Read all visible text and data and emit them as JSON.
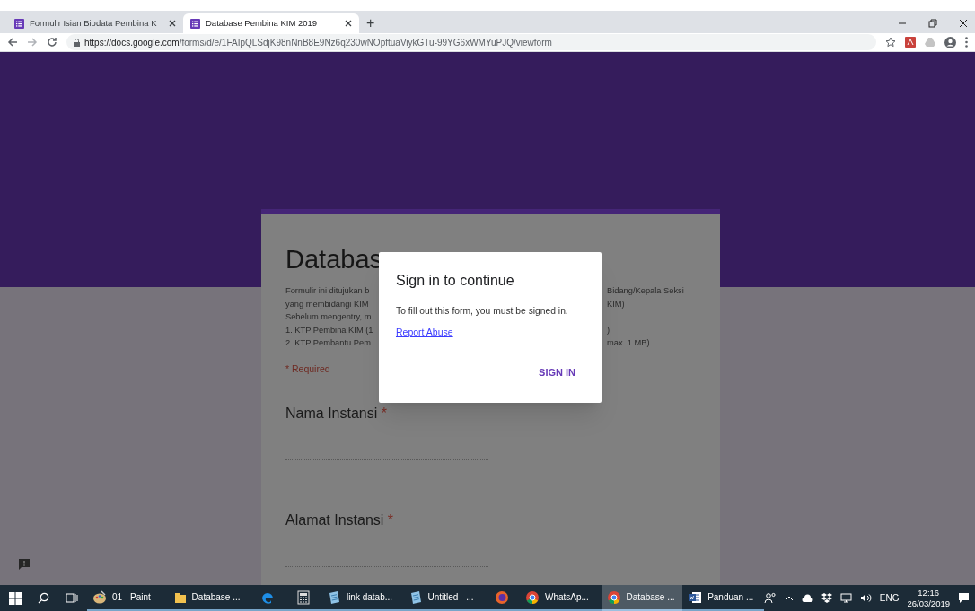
{
  "browser": {
    "tabs": [
      {
        "title": "Formulir Isian Biodata Pembina K",
        "selected": false
      },
      {
        "title": "Database Pembina KIM 2019",
        "selected": true
      }
    ],
    "new_tab": "+",
    "url_host": "https://docs.google.com",
    "url_path": "/forms/d/e/1FAIpQLSdjK98nNnB8E9Nz6q230wNOpftuaViykGTu-99YG6xWMYuPJQ/viewform"
  },
  "form": {
    "title": "Databas",
    "description_lines": [
      {
        "left": "Formulir ini ditujukan b",
        "right": "Bidang/Kepala Seksi"
      },
      {
        "left": "yang membidangi KIM",
        "right": "KIM)"
      },
      {
        "left": "Sebelum mengentry, m"
      },
      {
        "left": "1. KTP Pembina KIM (1",
        "right": ")"
      },
      {
        "left": "2. KTP Pembantu Pem",
        "right": "max. 1 MB)"
      }
    ],
    "required_note": "* Required",
    "questions": [
      {
        "label": "Nama Instansi",
        "mark": "*"
      },
      {
        "label": "Alamat Instansi",
        "mark": "*"
      }
    ]
  },
  "dialog": {
    "title": "Sign in to continue",
    "message": "To fill out this form, you must be signed in.",
    "link": "Report Abuse",
    "button": "SIGN IN"
  },
  "taskbar": {
    "items": [
      {
        "kind": "paint",
        "label": "01 - Paint",
        "selected": false
      },
      {
        "kind": "folder",
        "label": "Database ...",
        "selected": false
      },
      {
        "kind": "edge",
        "selected": false
      },
      {
        "kind": "calculator",
        "selected": false
      },
      {
        "kind": "notepad",
        "label": "link datab...",
        "selected": false
      },
      {
        "kind": "notepad",
        "label": "Untitled - ...",
        "selected": false
      },
      {
        "kind": "firefox",
        "selected": false
      },
      {
        "kind": "chrome",
        "label": "WhatsAp...",
        "selected": false
      },
      {
        "kind": "chrome",
        "label": "Database ...",
        "selected": true
      },
      {
        "kind": "word",
        "label": "Panduan ...",
        "selected": false
      }
    ],
    "language": "ENG",
    "time": "12:16",
    "date": "26/03/2019"
  }
}
